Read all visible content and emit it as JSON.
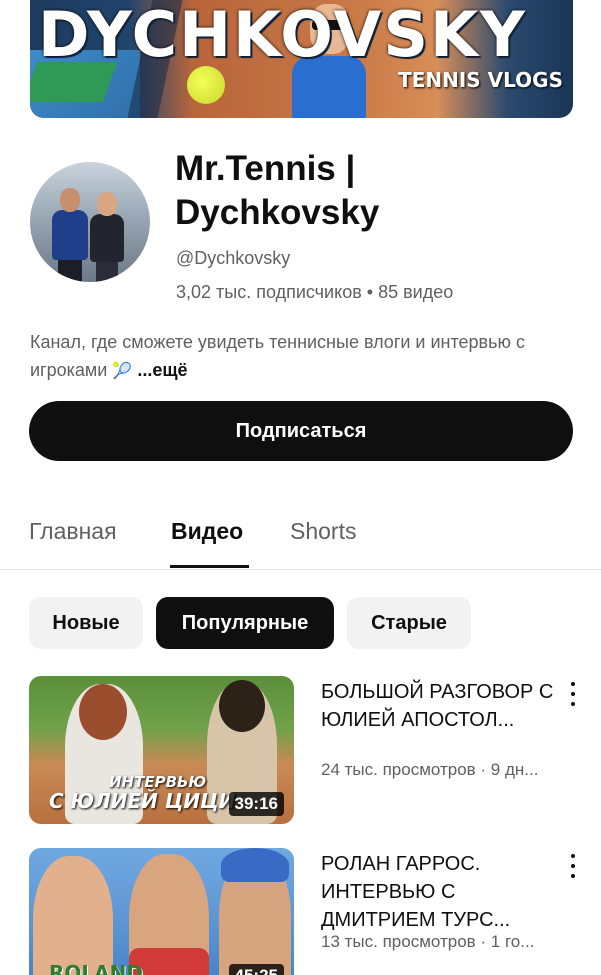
{
  "banner": {
    "big_text": "DYCHKOVSKY",
    "tag": "TENNIS VLOGS"
  },
  "channel": {
    "name": "Mr.Tennis | Dychkovsky",
    "handle": "@Dychkovsky",
    "stats": "3,02 тыс. подписчиков • 85 видео",
    "description": "Канал, где сможете увидеть теннисные влоги и интервью с игроками",
    "more_label": "...ещё",
    "subscribe_label": "Подписаться"
  },
  "tabs": [
    {
      "label": "Главная",
      "active": false
    },
    {
      "label": "Видео",
      "active": true
    },
    {
      "label": "Shorts",
      "active": false
    }
  ],
  "chips": [
    {
      "label": "Новые",
      "active": false
    },
    {
      "label": "Популярные",
      "active": true
    },
    {
      "label": "Старые",
      "active": false
    }
  ],
  "videos": [
    {
      "title": "БОЛЬШОЙ РАЗГОВОР С ЮЛИЕЙ АПОСТОЛ...",
      "meta": "24 тыс. просмотров · 9 дн...",
      "duration": "39:16",
      "thumb_text_top": "ИНТЕРВЬЮ",
      "thumb_text_bottom": "С ЮЛИЕЙ ЦИЦИ"
    },
    {
      "title": "РОЛАН ГАРРОС. ИНТЕРВЬЮ С ДМИТРИЕМ ТУРС...",
      "meta": "13 тыс. просмотров · 1 го...",
      "duration": "45:25",
      "thumb_text_bottom": "ROLAND"
    }
  ],
  "colors": {
    "text_primary": "#0f0f0f",
    "text_secondary": "#606060",
    "chip_bg": "#f2f2f2"
  }
}
